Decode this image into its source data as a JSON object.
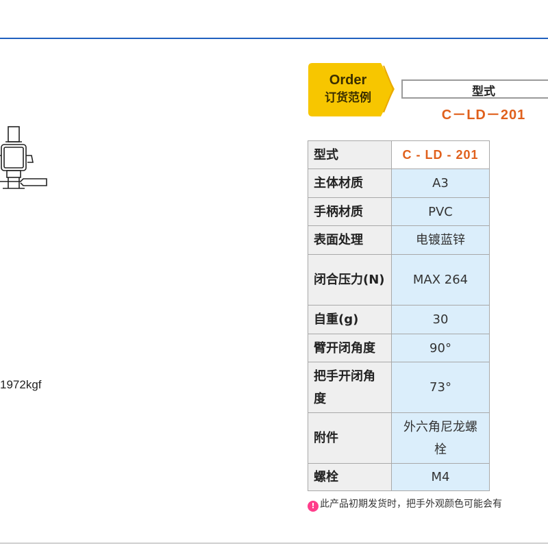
{
  "left": {
    "spec_fragment": "1972kgf"
  },
  "order": {
    "en": "Order",
    "zh": "订货范例",
    "model_label": "型式",
    "model_value": "C－LD－201"
  },
  "spec_table": {
    "rows": [
      {
        "key": "型式",
        "value": "C - LD - 201"
      },
      {
        "key": "主体材质",
        "value": "A3"
      },
      {
        "key": "手柄材质",
        "value": "PVC"
      },
      {
        "key": "表面处理",
        "value": "电镀蓝锌"
      },
      {
        "key": "闭合压力(N)",
        "value": "MAX 264"
      },
      {
        "key": "自重(g)",
        "value": "30"
      },
      {
        "key": "臂开闭角度",
        "value": "90°"
      },
      {
        "key": "把手开闭角度",
        "value": "73°"
      },
      {
        "key": "附件",
        "value": "外六角尼龙螺栓"
      },
      {
        "key": "螺栓",
        "value": "M4"
      }
    ]
  },
  "note": {
    "icon": "warning-bulb-icon",
    "text": "此产品初期发货时，把手外观颜色可能会有"
  },
  "colors": {
    "accent_blue": "#1f5fbf",
    "badge_yellow": "#f7c600",
    "model_orange": "#e0601c",
    "value_cell_blue": "#dbeefb"
  }
}
